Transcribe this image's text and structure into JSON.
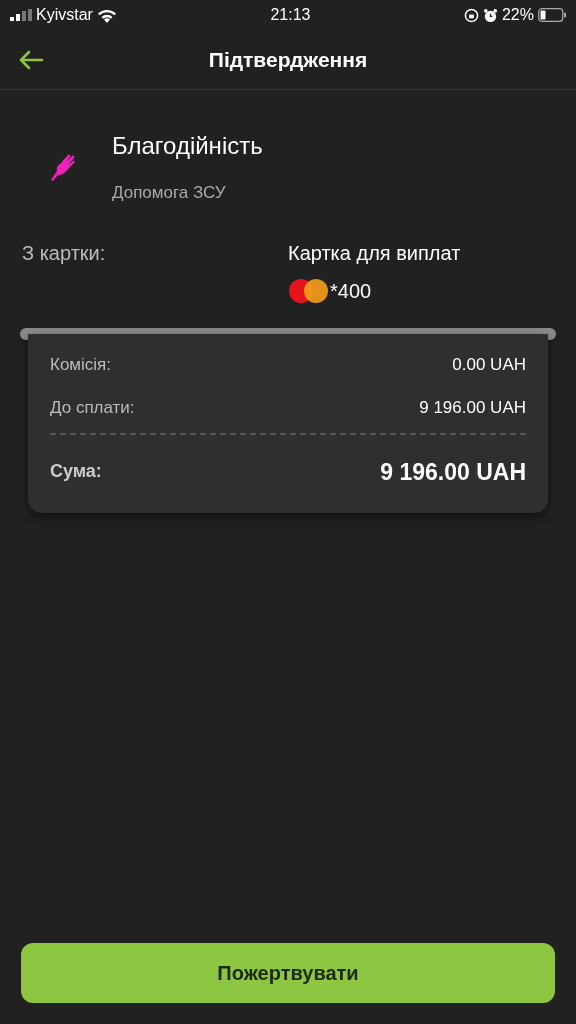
{
  "status_bar": {
    "carrier": "Kyivstar",
    "time": "21:13",
    "battery": "22%"
  },
  "header": {
    "title": "Підтвердження"
  },
  "recipient": {
    "title": "Благодійність",
    "subtitle": "Допомога ЗСУ"
  },
  "source": {
    "label": "З картки:",
    "card_name": "Картка для виплат",
    "card_number": "*400"
  },
  "receipt": {
    "rows": [
      {
        "kind": "normal",
        "label": "Комісія:",
        "value": "0.00 UAH"
      },
      {
        "kind": "normal",
        "label": "До сплати:",
        "value": "9 196.00 UAH"
      },
      {
        "kind": "total",
        "label": "Сума:",
        "value": "9 196.00 UAH"
      }
    ]
  },
  "action_button": "Пожертвувати"
}
